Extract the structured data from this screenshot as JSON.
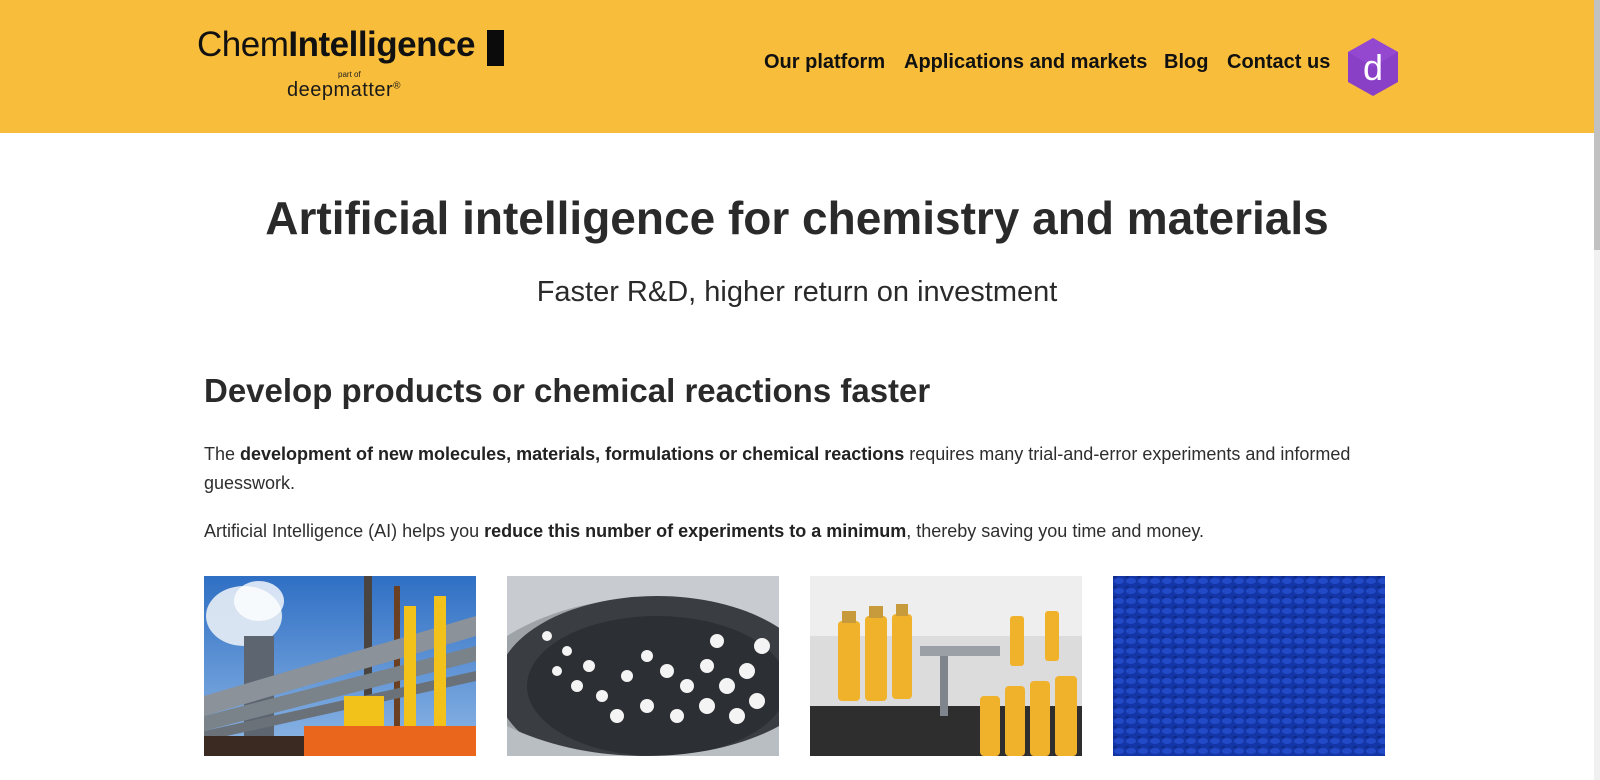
{
  "logo": {
    "part1": "Chem",
    "part2": "Intelligence",
    "part_of": "part of",
    "parent": "deepmatter",
    "parent_mark": "®"
  },
  "nav": {
    "items": [
      {
        "label": "Our platform"
      },
      {
        "label": "Applications and markets"
      },
      {
        "label": "Blog"
      },
      {
        "label": "Contact us"
      }
    ],
    "badge_letter": "d"
  },
  "hero": {
    "title": "Artificial intelligence for chemistry and materials",
    "subtitle": "Faster R&D, higher return on investment"
  },
  "section": {
    "heading": "Develop products or chemical reactions faster",
    "p1": {
      "before": "The ",
      "bold": "development of new molecules, materials, formulations or chemical reactions",
      "after": " requires many trial-and-error experiments and informed guesswork."
    },
    "p2": {
      "before": "Artificial Intelligence (AI) helps you ",
      "bold": "reduce this number of experiments to a minimum",
      "after": ", thereby saving you time and money."
    }
  },
  "colors": {
    "header_bg": "#f8bd3a",
    "badge": "#8a3fc7",
    "text": "#2a2a2a"
  }
}
